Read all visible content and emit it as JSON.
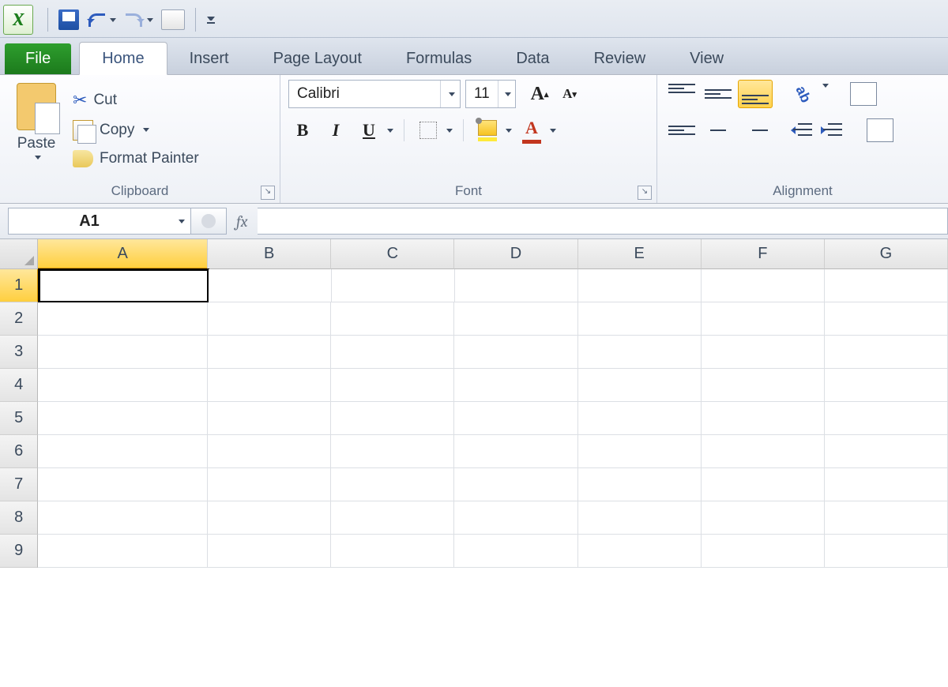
{
  "qat": {
    "save": "save",
    "undo": "undo",
    "redo": "redo",
    "print": "print-preview"
  },
  "tabs": {
    "file": "File",
    "home": "Home",
    "insert": "Insert",
    "page": "Page Layout",
    "formulas": "Formulas",
    "data": "Data",
    "review": "Review",
    "view": "View",
    "active": "home"
  },
  "ribbon": {
    "clipboard": {
      "label": "Clipboard",
      "paste": "Paste",
      "cut": "Cut",
      "copy": "Copy",
      "format_painter": "Format Painter"
    },
    "font": {
      "label": "Font",
      "name": "Calibri",
      "size": "11"
    },
    "alignment": {
      "label": "Alignment"
    }
  },
  "formula_bar": {
    "name_box": "A1",
    "fx": "fx",
    "formula": ""
  },
  "grid": {
    "columns": [
      "A",
      "B",
      "C",
      "D",
      "E",
      "F",
      "G"
    ],
    "rows": [
      "1",
      "2",
      "3",
      "4",
      "5",
      "6",
      "7",
      "8",
      "9"
    ],
    "active_cell": "A1",
    "selected_column": "A",
    "selected_row": "1"
  }
}
